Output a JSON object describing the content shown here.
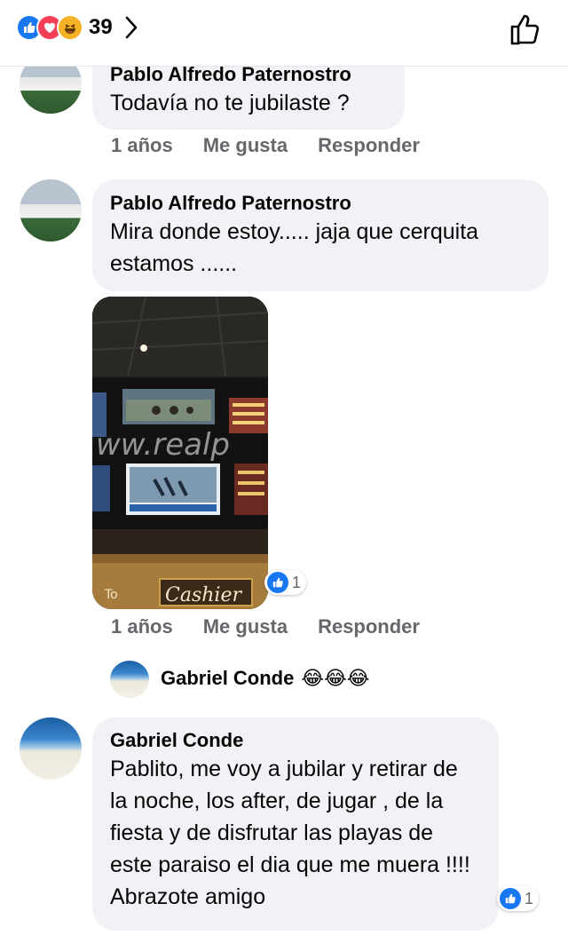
{
  "header": {
    "reaction_icons": [
      "like-icon",
      "love-icon",
      "haha-icon"
    ],
    "reaction_count": "39",
    "like_button_icon": "thumbs-up-outline-icon"
  },
  "comments": [
    {
      "author": "Pablo Alfredo Paternostro",
      "text": "Todavía no te jubilaste ?",
      "time": "1 años",
      "like_label": "Me gusta",
      "reply_label": "Responder"
    },
    {
      "author": "Pablo Alfredo Paternostro",
      "text": "Mira donde estoy..... jaja que cerquita estamos ......",
      "photo": {
        "watermark": "ww.realp",
        "sign": "Cashier",
        "description_icon": "casino-screens-photo"
      },
      "reaction_count": "1",
      "time": "1 años",
      "like_label": "Me gusta",
      "reply_label": "Responder"
    },
    {
      "author": "Gabriel Conde",
      "emoji": "😂😂😂"
    },
    {
      "author": "Gabriel Conde",
      "text": "Pablito, me voy a jubilar y retirar de la noche, los after, de jugar , de la fiesta y de disfrutar las playas de este paraiso el dia que me muera !!!! Abrazote amigo",
      "reaction_count": "1"
    }
  ],
  "colors": {
    "like_blue": "#1877f2",
    "love_red": "#f33e58",
    "haha_yellow": "#f7b125",
    "bubble_gray": "#f0f2f5",
    "meta_gray": "#65676b"
  }
}
